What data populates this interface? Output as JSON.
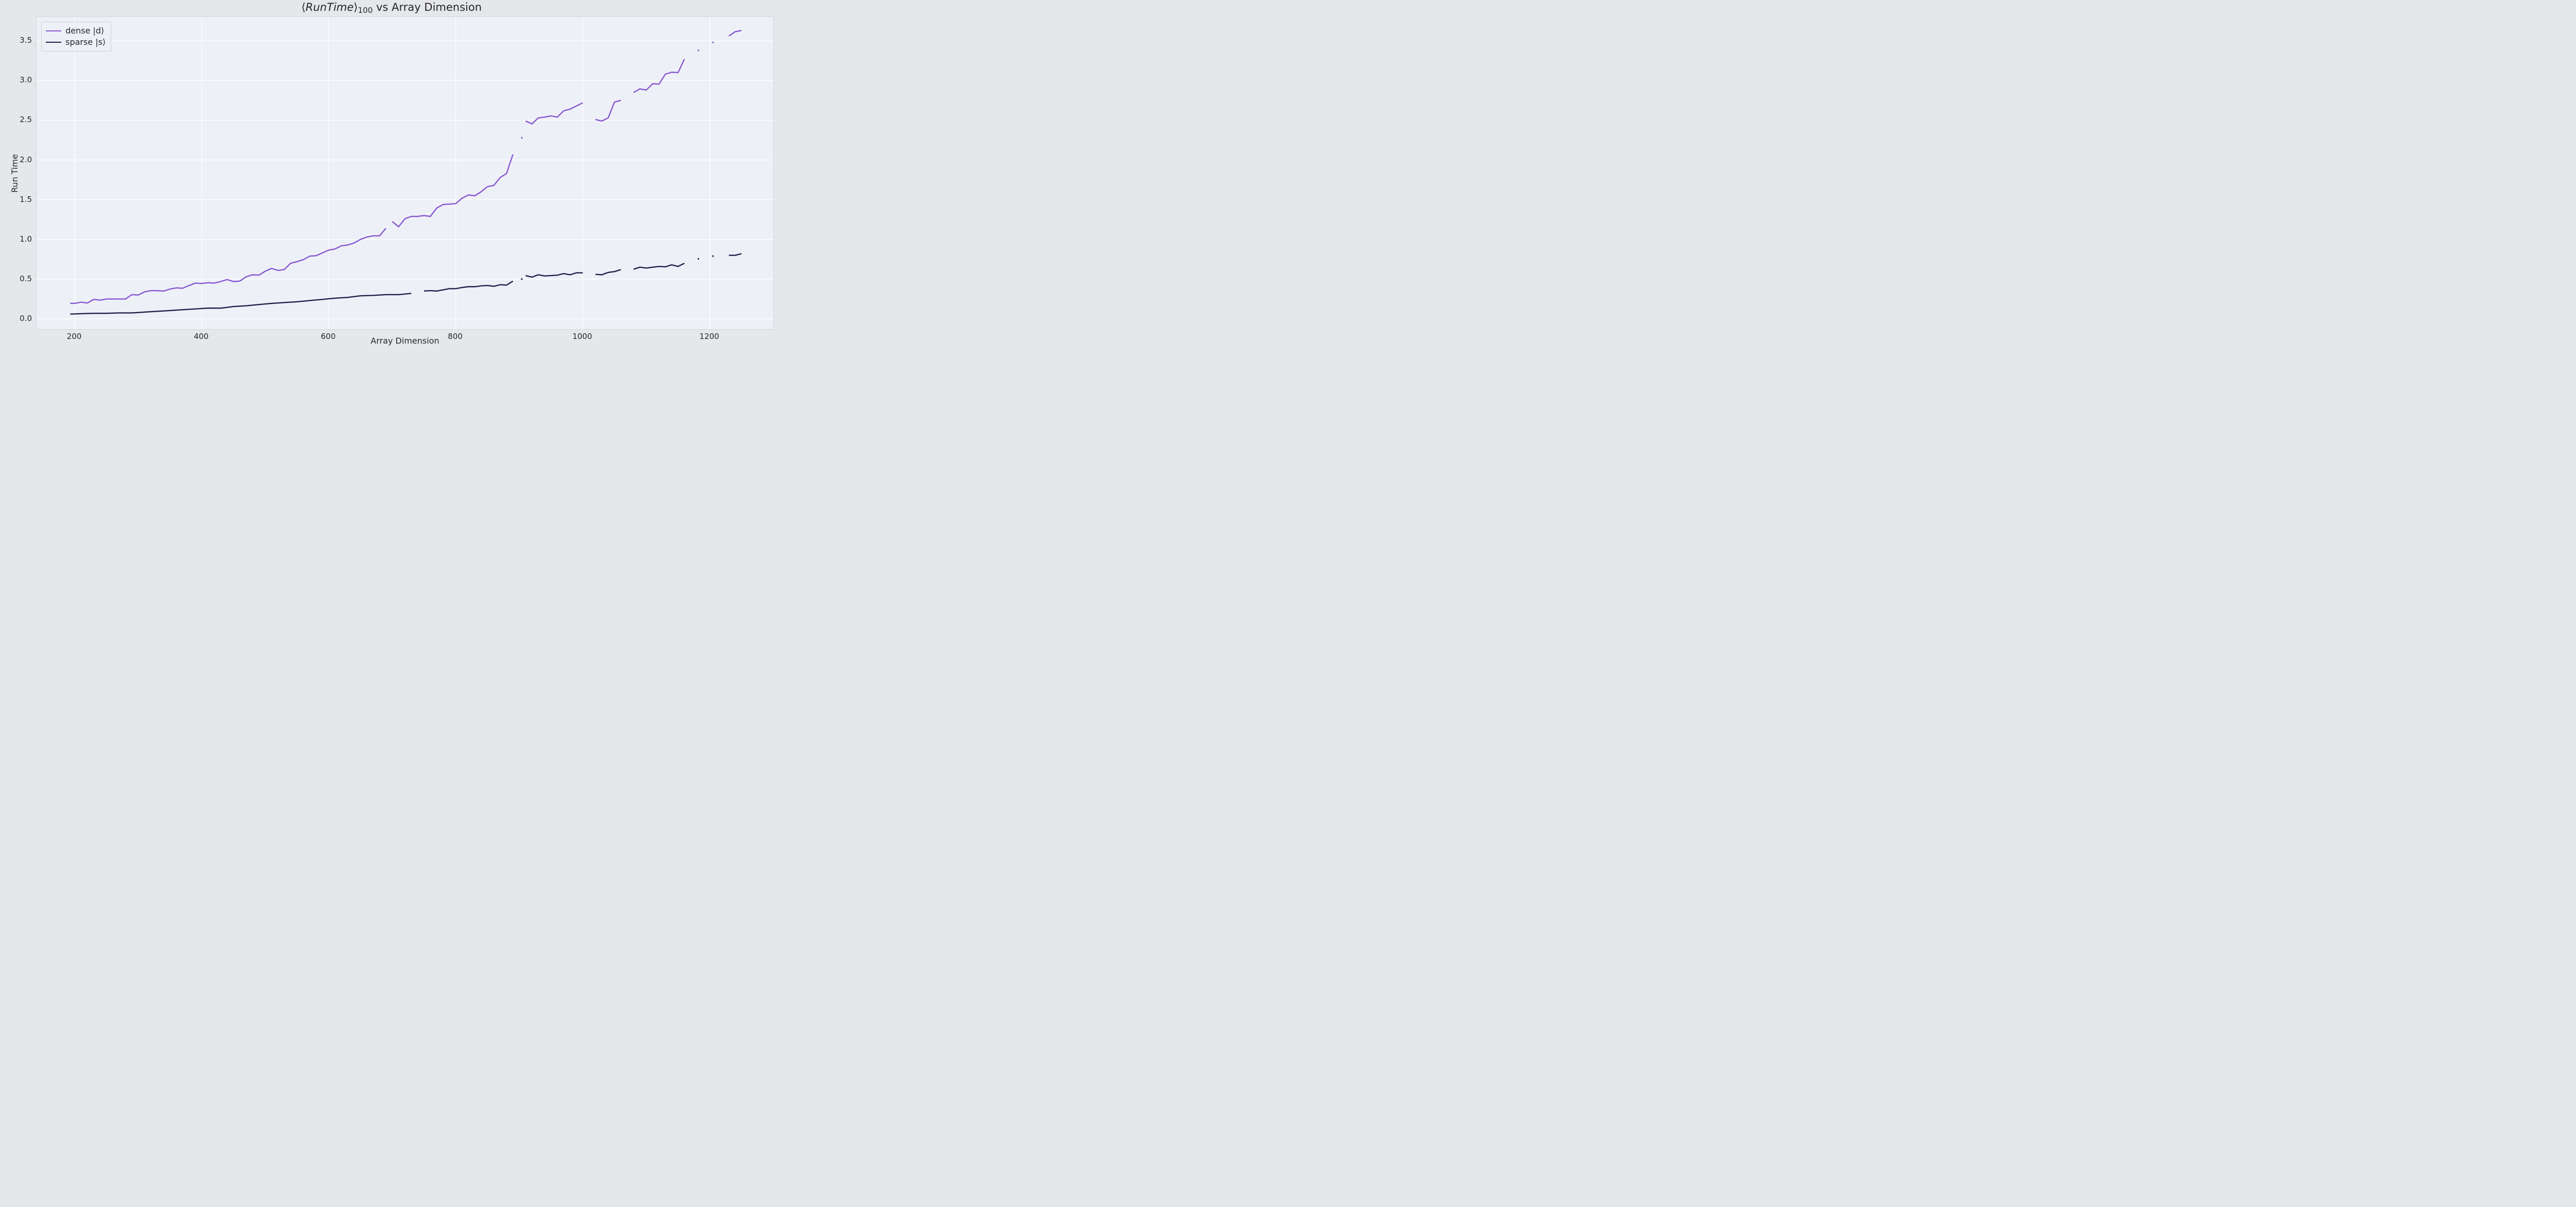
{
  "chart_data": {
    "type": "line",
    "title_html": "⟨<span class='it'>RunTime</span>⟩<span class='sub'>100</span> vs Array Dimension",
    "xlabel": "Array Dimension",
    "ylabel": "Run Time",
    "xlim": [
      140,
      1300
    ],
    "ylim": [
      -0.13,
      3.8
    ],
    "xticks": [
      200,
      400,
      600,
      800,
      1000,
      1200
    ],
    "yticks": [
      0.0,
      0.5,
      1.0,
      1.5,
      2.0,
      2.5,
      3.0,
      3.5
    ],
    "legend_position": "upper left",
    "grid": true,
    "series": [
      {
        "name": "dense |d⟩",
        "color": "#8757d1",
        "segments": [
          {
            "x": [
              193,
              200,
              210,
              220,
              230,
              240,
              250,
              260,
              270,
              280,
              290,
              300,
              310,
              320,
              330,
              340,
              350,
              360,
              370,
              380,
              390,
              400,
              410,
              420,
              430,
              440,
              450,
              460,
              470,
              480,
              490,
              500,
              510,
              520,
              530,
              540,
              550,
              560,
              570,
              580,
              590,
              600,
              610,
              620,
              630,
              640,
              650,
              660,
              670,
              680,
              690
            ],
            "y": [
              0.195,
              0.195,
              0.21,
              0.2,
              0.245,
              0.235,
              0.25,
              0.25,
              0.25,
              0.25,
              0.305,
              0.3,
              0.34,
              0.355,
              0.355,
              0.35,
              0.375,
              0.39,
              0.385,
              0.42,
              0.45,
              0.445,
              0.455,
              0.45,
              0.47,
              0.495,
              0.47,
              0.475,
              0.53,
              0.555,
              0.55,
              0.6,
              0.635,
              0.61,
              0.62,
              0.7,
              0.72,
              0.745,
              0.79,
              0.795,
              0.83,
              0.865,
              0.88,
              0.92,
              0.93,
              0.955,
              1.0,
              1.03,
              1.045,
              1.045,
              1.14
            ]
          },
          {
            "x": [
              700,
              710,
              720,
              730,
              740,
              750,
              760,
              770,
              780,
              790,
              800,
              810,
              820,
              830,
              840,
              850,
              860,
              870,
              880,
              890
            ],
            "y": [
              1.225,
              1.16,
              1.26,
              1.29,
              1.29,
              1.3,
              1.29,
              1.395,
              1.44,
              1.445,
              1.45,
              1.52,
              1.56,
              1.55,
              1.6,
              1.665,
              1.68,
              1.78,
              1.83,
              2.07
            ]
          },
          {
            "x": [
              910,
              920,
              930,
              940,
              950,
              960,
              970,
              980,
              990,
              1000
            ],
            "y": [
              2.49,
              2.455,
              2.53,
              2.54,
              2.555,
              2.54,
              2.62,
              2.64,
              2.68,
              2.72
            ]
          },
          {
            "x": [
              1020,
              1030,
              1040,
              1050,
              1060
            ],
            "y": [
              2.51,
              2.49,
              2.53,
              2.73,
              2.75
            ]
          },
          {
            "x": [
              1080,
              1090,
              1100,
              1110,
              1120,
              1130,
              1140,
              1150,
              1160
            ],
            "y": [
              2.85,
              2.895,
              2.88,
              2.96,
              2.955,
              3.08,
              3.105,
              3.1,
              3.27
            ]
          },
          {
            "x": [
              1230,
              1240,
              1250
            ],
            "y": [
              3.56,
              3.615,
              3.63
            ]
          }
        ],
        "dots": [
          {
            "x": 904,
            "y": 2.28
          },
          {
            "x": 1182,
            "y": 3.38
          },
          {
            "x": 1205,
            "y": 3.48
          }
        ]
      },
      {
        "name": "sparse |s⟩",
        "color": "#241d4a",
        "segments": [
          {
            "x": [
              193,
              210,
              230,
              250,
              270,
              290,
              310,
              330,
              350,
              370,
              390,
              410,
              430,
              450,
              470,
              490,
              510,
              530,
              550,
              570,
              590,
              610,
              630,
              650,
              670,
              690,
              710,
              730
            ],
            "y": [
              0.06,
              0.065,
              0.07,
              0.07,
              0.075,
              0.075,
              0.085,
              0.095,
              0.105,
              0.115,
              0.125,
              0.135,
              0.135,
              0.155,
              0.165,
              0.18,
              0.195,
              0.205,
              0.215,
              0.23,
              0.245,
              0.26,
              0.27,
              0.29,
              0.295,
              0.305,
              0.305,
              0.32
            ]
          },
          {
            "x": [
              750,
              760,
              770,
              780,
              790,
              800,
              810,
              820,
              830,
              840,
              850,
              860,
              870,
              880,
              890
            ],
            "y": [
              0.35,
              0.355,
              0.35,
              0.365,
              0.38,
              0.38,
              0.395,
              0.405,
              0.405,
              0.415,
              0.42,
              0.41,
              0.43,
              0.425,
              0.475
            ]
          },
          {
            "x": [
              910,
              920,
              930,
              940,
              950,
              960,
              970,
              980,
              990,
              1000
            ],
            "y": [
              0.545,
              0.525,
              0.555,
              0.54,
              0.545,
              0.55,
              0.57,
              0.555,
              0.58,
              0.58
            ]
          },
          {
            "x": [
              1020,
              1030,
              1040,
              1050,
              1060
            ],
            "y": [
              0.56,
              0.555,
              0.585,
              0.595,
              0.62
            ]
          },
          {
            "x": [
              1080,
              1090,
              1100,
              1110,
              1120,
              1130,
              1140,
              1150,
              1160
            ],
            "y": [
              0.625,
              0.65,
              0.64,
              0.65,
              0.66,
              0.655,
              0.68,
              0.66,
              0.7
            ]
          },
          {
            "x": [
              1230,
              1240,
              1250
            ],
            "y": [
              0.8,
              0.8,
              0.82
            ]
          }
        ],
        "dots": [
          {
            "x": 904,
            "y": 0.5
          },
          {
            "x": 1182,
            "y": 0.755
          },
          {
            "x": 1205,
            "y": 0.79
          }
        ]
      }
    ]
  }
}
